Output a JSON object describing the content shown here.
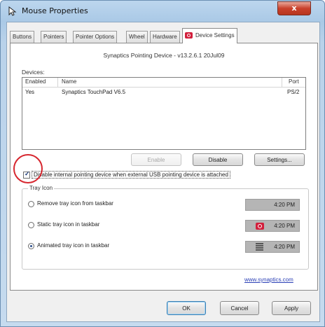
{
  "window": {
    "title": "Mouse Properties",
    "close_label": "x"
  },
  "tabs": [
    {
      "label": "Buttons"
    },
    {
      "label": "Pointers"
    },
    {
      "label": "Pointer Options"
    },
    {
      "label": "Wheel"
    },
    {
      "label": "Hardware"
    },
    {
      "label": "Device Settings",
      "active": true
    }
  ],
  "device_header": "Synaptics Pointing Device - v13.2.6.1 20Jul09",
  "devices": {
    "label": "Devices:",
    "columns": [
      "Enabled",
      "Name",
      "Port"
    ],
    "rows": [
      {
        "enabled": "Yes",
        "name": "Synaptics TouchPad V6.5",
        "port": "PS/2"
      }
    ]
  },
  "buttons": {
    "enable": "Enable",
    "disable": "Disable",
    "settings": "Settings..."
  },
  "checkbox": {
    "label": "Disable internal pointing device when external USB pointing device is attached",
    "checked": true
  },
  "tray": {
    "group_title": "Tray Icon",
    "options": [
      {
        "label": "Remove tray icon from taskbar",
        "checked": false,
        "time": "4:20 PM"
      },
      {
        "label": "Static tray icon in taskbar",
        "checked": false,
        "time": "4:20 PM"
      },
      {
        "label": "Animated tray icon in taskbar",
        "checked": true,
        "time": "4:20 PM"
      }
    ]
  },
  "link": "www.synaptics.com",
  "footer": {
    "ok": "OK",
    "cancel": "Cancel",
    "apply": "Apply"
  },
  "colors": {
    "accent_red": "#d21f3c",
    "highlight_circle": "#d7272f",
    "link": "#2a3fb5"
  }
}
